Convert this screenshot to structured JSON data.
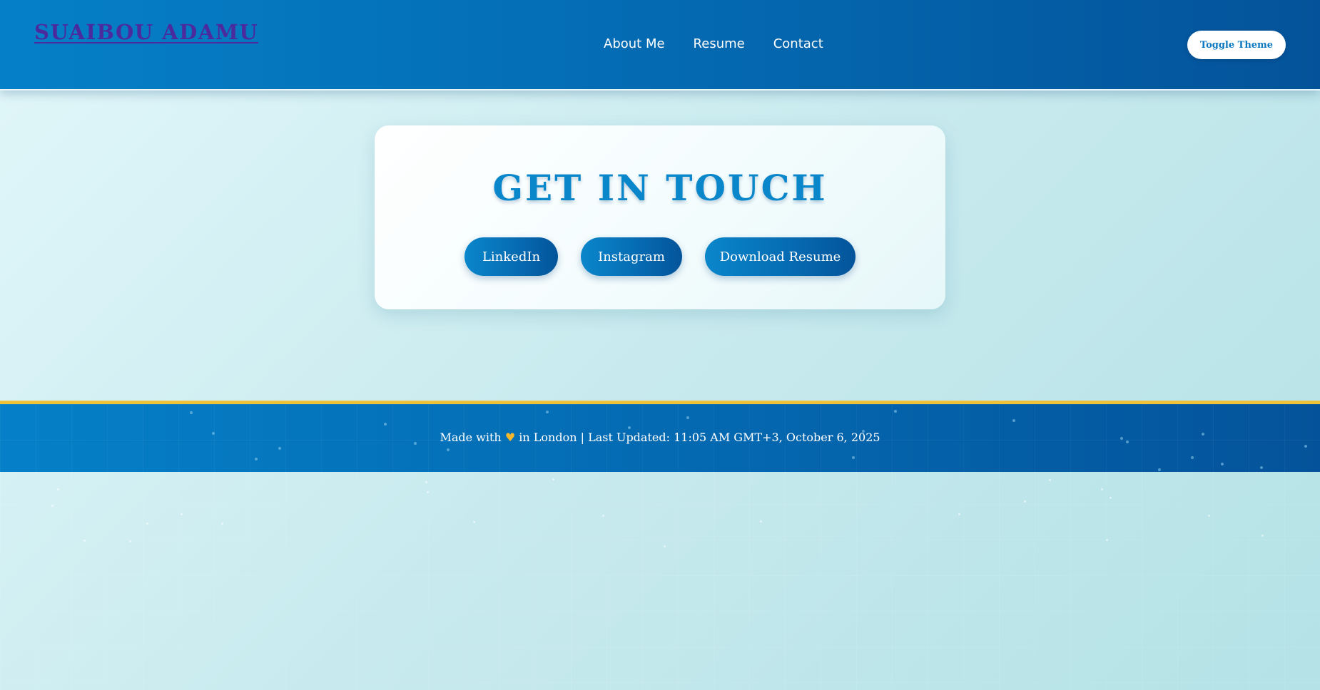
{
  "header": {
    "brand": "SUAIBOU ADAMU",
    "nav": [
      {
        "label": "About Me"
      },
      {
        "label": "Resume"
      },
      {
        "label": "Contact"
      }
    ],
    "theme_button": "Toggle Theme"
  },
  "contact": {
    "title": "GET IN TOUCH",
    "buttons": {
      "linkedin": "LinkedIn",
      "instagram": "Instagram",
      "resume": "Download Resume"
    }
  },
  "footer": {
    "made_with": "Made with",
    "heart": "♥",
    "rest": "in London | Last Updated: 11:05 AM GMT+3, October 6, 2025"
  },
  "colors": {
    "header_gradient_start": "#0580c8",
    "header_gradient_end": "#04539a",
    "brand": "#4b2a9e",
    "accent_title": "#0a86cb",
    "footer_border": "#f0c23a",
    "heart": "#f5b82a",
    "background": "#c8eaee"
  }
}
